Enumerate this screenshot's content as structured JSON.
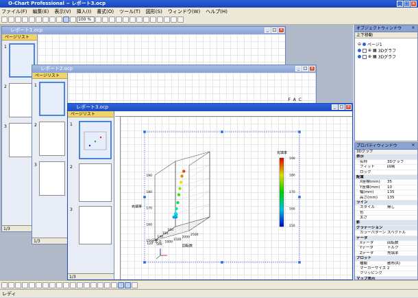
{
  "app": {
    "title": "O-Chart Professional − レポート3.ocp",
    "min": "_",
    "max": "□",
    "close": "×"
  },
  "menu": [
    "ファイル(F)",
    "編集(E)",
    "表示(V)",
    "挿入(I)",
    "書式(O)",
    "ツール(T)",
    "図形(S)",
    "ウィンドウ(W)",
    "ヘルプ(H)"
  ],
  "toolbar": {
    "zoom": "100 %"
  },
  "windows": [
    {
      "title": "レポート1.ocp",
      "pagelist": "ページリスト",
      "pages": [
        "1",
        "2",
        "3"
      ],
      "footer": "1/3"
    },
    {
      "title": "レポート2.ocp",
      "pagelist": "ページリスト",
      "pages": [
        "1",
        "2",
        "3"
      ],
      "footer": "1/3"
    },
    {
      "title": "レポート3.ocp",
      "pagelist": "ページリスト",
      "pages": [
        "1",
        "2",
        "3"
      ],
      "footer": "1/3"
    }
  ],
  "report2_text": "F A C",
  "chart_data": {
    "type": "scatter",
    "zlabel": "充填率",
    "xlabel": "トルク",
    "ylabel": "回転数",
    "colorbar_label": "充填率",
    "z_ticks": [
      "150",
      "160",
      "170",
      "180",
      "190"
    ],
    "x_ticks": [
      "160",
      "150",
      "140",
      "130",
      "120"
    ],
    "y_ticks": [
      "500",
      "1000",
      "1500",
      "2000",
      "2500"
    ],
    "colorbar_ticks": [
      "190",
      "180",
      "170",
      "160",
      "150"
    ],
    "points": [
      {
        "x": 158,
        "y": 600,
        "z": 156
      },
      {
        "x": 155,
        "y": 700,
        "z": 158
      },
      {
        "x": 152,
        "y": 650,
        "z": 157
      },
      {
        "x": 150,
        "y": 800,
        "z": 159
      },
      {
        "x": 147,
        "y": 900,
        "z": 158
      },
      {
        "x": 144,
        "y": 1000,
        "z": 160
      },
      {
        "x": 142,
        "y": 1100,
        "z": 163
      },
      {
        "x": 138,
        "y": 1300,
        "z": 167
      },
      {
        "x": 135,
        "y": 1450,
        "z": 172
      },
      {
        "x": 132,
        "y": 1600,
        "z": 176
      },
      {
        "x": 129,
        "y": 1750,
        "z": 180
      },
      {
        "x": 126,
        "y": 1900,
        "z": 184
      },
      {
        "x": 123,
        "y": 2100,
        "z": 187
      }
    ]
  },
  "object_window": {
    "title": "オブジェクトウィンドウ",
    "toolbar": "上下移動",
    "items": [
      {
        "label": "ページ1"
      },
      {
        "label": "3Dグラフ"
      },
      {
        "label": "3Dグラフ"
      }
    ]
  },
  "property_window": {
    "title": "プロパティウィンドウ",
    "header": "3Dグラフ",
    "rows": [
      {
        "k": "表示",
        "v": "",
        "sec": true
      },
      {
        "k": "名称",
        "v": "3Dグラフ"
      },
      {
        "k": "フィット",
        "v": "四隅"
      },
      {
        "k": "ロック",
        "v": ""
      },
      {
        "k": "配置",
        "v": "",
        "sec": true
      },
      {
        "k": "X座標(mm)",
        "v": "35"
      },
      {
        "k": "Y座標(mm)",
        "v": "10"
      },
      {
        "k": "幅(mm)",
        "v": "135"
      },
      {
        "k": "高さ(mm)",
        "v": "135"
      },
      {
        "k": "ライン",
        "v": "",
        "sec": true
      },
      {
        "k": "スタイル",
        "v": "無し"
      },
      {
        "k": "色",
        "v": ""
      },
      {
        "k": "太さ",
        "v": ""
      },
      {
        "k": "影",
        "v": "",
        "sec": true
      },
      {
        "k": "グラデーション",
        "v": "",
        "sec": true
      },
      {
        "k": "カラーパターン",
        "v": "スペクトル"
      },
      {
        "k": "データ",
        "v": "",
        "sec": true
      },
      {
        "k": "Xデータ",
        "v": "回転数"
      },
      {
        "k": "Yデータ",
        "v": "トルク"
      },
      {
        "k": "Zデータ",
        "v": "充填率"
      },
      {
        "k": "プロット",
        "v": "",
        "sec": true
      },
      {
        "k": "種類",
        "v": "散布(R)"
      },
      {
        "k": "マーカーサイズ",
        "v": "2"
      },
      {
        "k": "クリッピング",
        "v": ""
      },
      {
        "k": "マップ表示",
        "v": "",
        "sec": true
      }
    ]
  },
  "status": "レディ"
}
